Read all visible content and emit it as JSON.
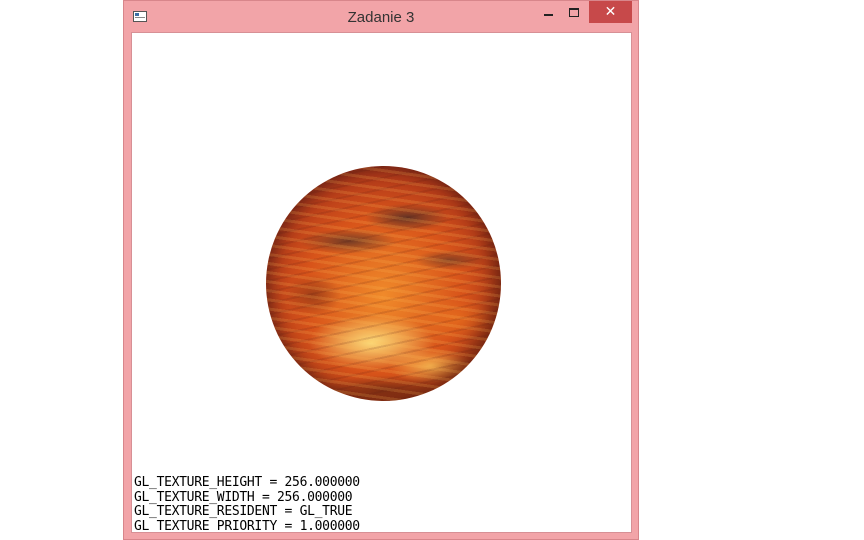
{
  "window": {
    "title": "Zadanie 3",
    "close_glyph": "✕",
    "close_color": "#c7494a",
    "frame_color": "#f2a4a8"
  },
  "icons": {
    "app": "app-window-icon",
    "minimize": "minimize-icon",
    "maximize": "maximize-icon",
    "close": "close-icon"
  },
  "scene": {
    "object": "textured-sphere",
    "texture_colors": [
      "#f08a2a",
      "#d8541a",
      "#a8331a",
      "#5a2418",
      "#ffe682"
    ]
  },
  "texture_info": [
    "GL_TEXTURE_HEIGHT = 256.000000",
    "GL_TEXTURE_WIDTH = 256.000000",
    "GL_TEXTURE_RESIDENT = GL_TRUE",
    "GL_TEXTURE_PRIORITY = 1.000000"
  ]
}
